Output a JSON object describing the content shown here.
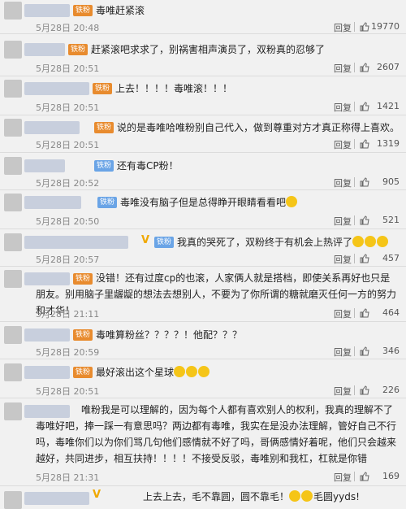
{
  "reply_label": "回复",
  "comments": [
    {
      "badge": "铁粉",
      "text": "毒唯赶紧滚",
      "time": "5月28日 20:48",
      "likes": "19770"
    },
    {
      "badge": "铁粉",
      "text": "赶紧滚吧求求了，别祸害相声演员了，双粉真的忍够了",
      "time": "5月28日 20:51",
      "likes": "2607"
    },
    {
      "badge": "铁粉",
      "text": "上去！！！！毒唯滚！！！",
      "time": "5月28日 20:51",
      "likes": "1421"
    },
    {
      "badge": "铁粉",
      "text": "说的是毒唯哈唯粉别自己代入，做到尊重对方才真正称得上喜欢。",
      "time": "5月28日 20:51",
      "likes": "1319"
    },
    {
      "badge": "铁粉",
      "text": "还有毒CP粉！",
      "time": "5月28日 20:52",
      "likes": "905"
    },
    {
      "badge": "铁粉",
      "text": "毒唯没有脑子但是总得睁开眼睛看看吧",
      "time": "5月28日 20:50",
      "likes": "521"
    },
    {
      "badge": "铁粉",
      "text": "我真的哭死了，双粉终于有机会上热评了",
      "time": "5月28日 20:57",
      "likes": "457"
    },
    {
      "badge": "铁粉",
      "text": "没错！还有过度cp的也滚，人家俩人就是搭档，即使关系再好也只是朋友。别用脑子里龌龊的想法去想别人，不要为了你所谓的糖就磨灭任何一方的努力和才华！",
      "time": "5月28日 21:11",
      "likes": "464"
    },
    {
      "badge": "铁粉",
      "text": "毒唯算粉丝？？？？！他配？？？",
      "time": "5月28日 20:59",
      "likes": "346"
    },
    {
      "badge": "铁粉",
      "text": "最好滚出这个星球",
      "time": "5月28日 20:51",
      "likes": "226"
    },
    {
      "badge": "",
      "text": "唯粉我是可以理解的，因为每个人都有喜欢别人的权利，我真的理解不了毒唯好吧，捧一踩一有意思吗？两边都有毒唯，我实在是没办法理解，管好自己不行吗，毒唯你们以为你们骂几句他们感情就不好了吗，哥俩感情好着呢，他们只会越来越好，共同进步，相互扶持！！！！不接受反驳，毒唯别和我杠，杠就是你错",
      "time": "5月28日 21:31",
      "likes": "169"
    },
    {
      "badge": "",
      "text": "上去上去，毛不靠圆，圆不靠毛！",
      "text2": "毛圆yyds!",
      "time": "",
      "likes": ""
    }
  ]
}
